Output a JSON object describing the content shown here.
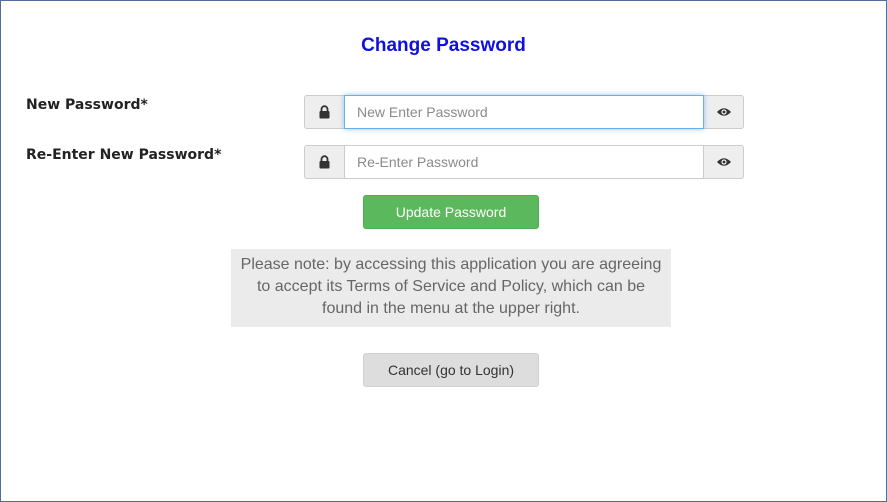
{
  "page": {
    "title": "Change Password"
  },
  "form": {
    "new_password": {
      "label": "New Password*",
      "placeholder": "New Enter Password",
      "value": "",
      "left_icon": "lock-icon",
      "right_icon": "eye-icon"
    },
    "reenter_password": {
      "label": "Re-Enter New Password*",
      "placeholder": "Re-Enter Password",
      "value": "",
      "left_icon": "lock-icon",
      "right_icon": "eye-icon"
    }
  },
  "buttons": {
    "update_label": "Update Password",
    "cancel_label": "Cancel (go to Login)"
  },
  "notice": {
    "text": "Please note: by accessing this application you are agreeing to accept its Terms of Service and Policy, which can be found in the menu at the upper right."
  },
  "colors": {
    "title": "#1010e0",
    "update_button": "#5cb85c",
    "cancel_button": "#dddddd",
    "notice_background": "#ebebeb",
    "focus_border": "#66afe9",
    "window_border": "#4f6f9a"
  }
}
